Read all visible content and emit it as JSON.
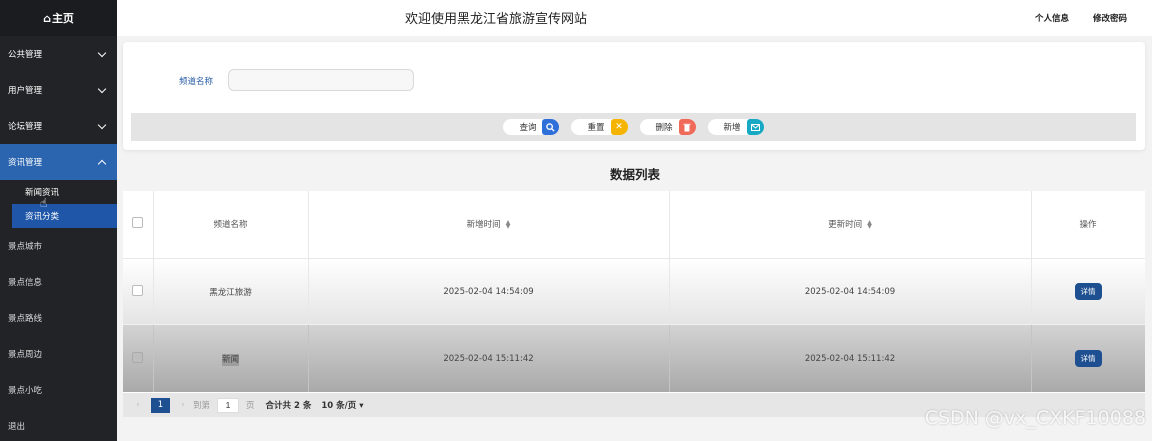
{
  "sidebar": {
    "home_label": "主页",
    "menus": [
      {
        "label": "公共管理"
      },
      {
        "label": "用户管理"
      },
      {
        "label": "论坛管理"
      },
      {
        "label": "资讯管理"
      }
    ],
    "submenus": [
      {
        "label": "新闻资讯"
      },
      {
        "label": "资讯分类"
      }
    ],
    "items": [
      {
        "label": "景点城市"
      },
      {
        "label": "景点信息"
      },
      {
        "label": "景点路线"
      },
      {
        "label": "景点周边"
      },
      {
        "label": "景点小吃"
      },
      {
        "label": "退出"
      }
    ]
  },
  "header": {
    "title": "欢迎使用黑龙江省旅游宣传网站",
    "profile_link": "个人信息",
    "password_link": "修改密码"
  },
  "search": {
    "field_label": "频道名称",
    "field_value": "",
    "buttons": {
      "query": "查询",
      "reset": "重置",
      "delete": "删除",
      "add": "新增"
    },
    "colors": {
      "query": "#2f6fd9",
      "reset": "#f5b400",
      "delete": "#f06a5a",
      "add": "#17a9c4"
    }
  },
  "list": {
    "title": "数据列表",
    "columns": [
      "频道名称",
      "新增时间",
      "更新时间",
      "操作"
    ],
    "rows": [
      {
        "name": "黑龙江旅游",
        "created": "2025-02-04 14:54:09",
        "updated": "2025-02-04 14:54:09",
        "action": "详情"
      },
      {
        "name": "新闻",
        "created": "2025-02-04 15:11:42",
        "updated": "2025-02-04 15:11:42",
        "action": "详情"
      }
    ]
  },
  "pagination": {
    "current_page": "1",
    "goto_label": "到第",
    "goto_value": "1",
    "page_unit": "页",
    "total": "合计共 2 条",
    "page_size": "10 条/页"
  },
  "watermark": "CSDN @vx_CXKF10088"
}
